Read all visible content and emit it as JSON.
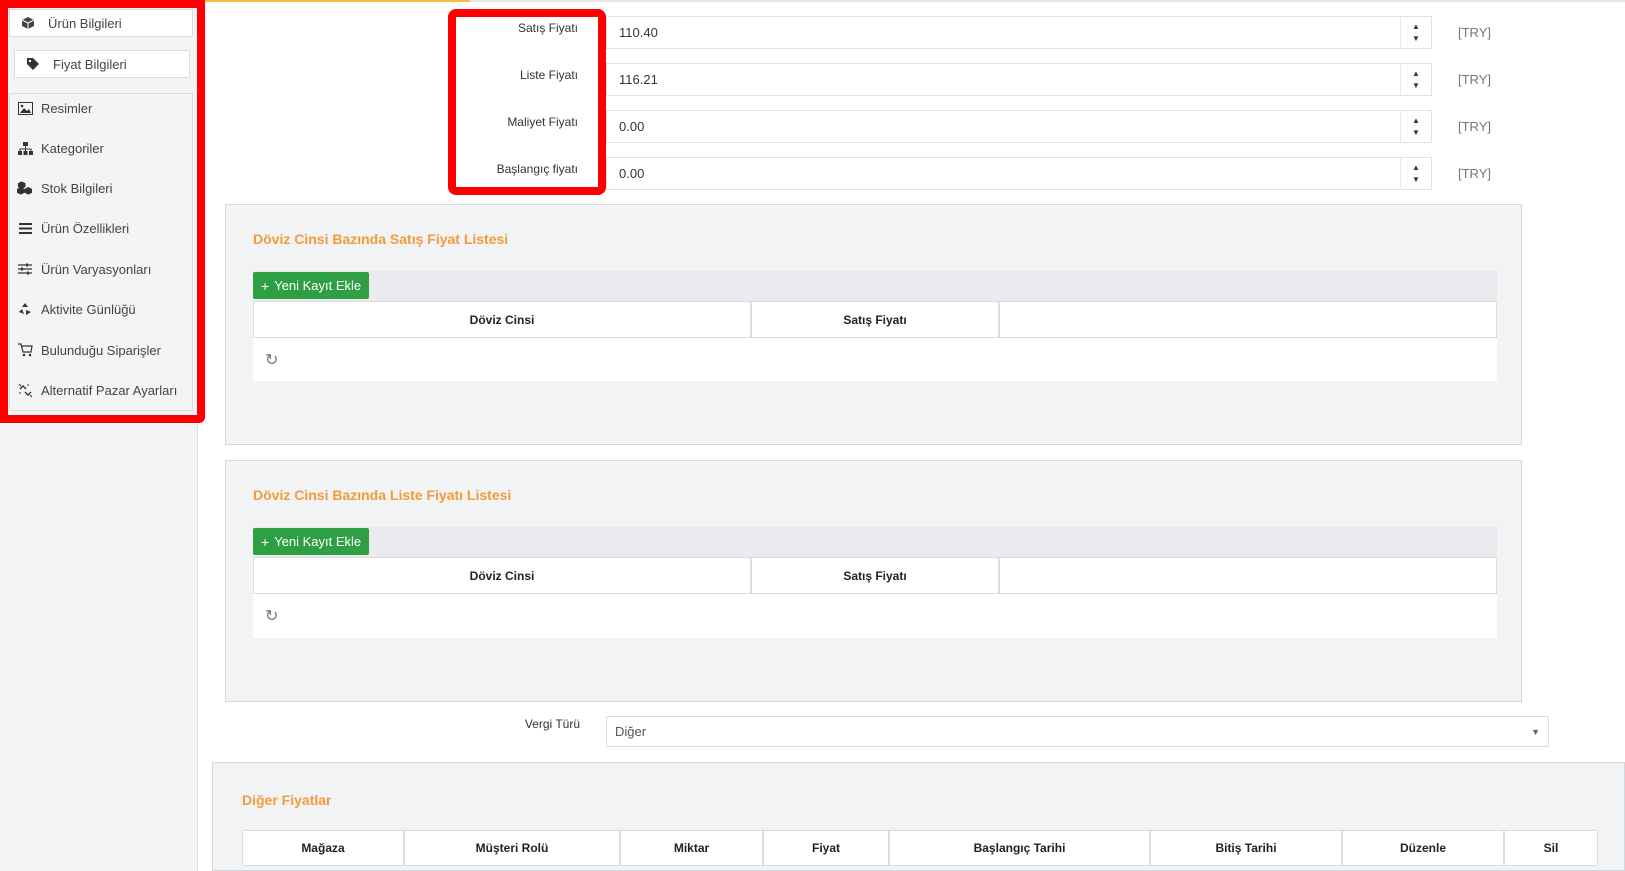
{
  "sidebar": {
    "tabs": [
      {
        "label": "Ürün Bilgileri",
        "icon": "cube-icon"
      },
      {
        "label": "Fiyat Bilgileri",
        "icon": "tag-icon"
      }
    ],
    "items": [
      {
        "label": "Resimler",
        "icon": "image-icon"
      },
      {
        "label": "Kategoriler",
        "icon": "sitemap-icon"
      },
      {
        "label": "Stok Bilgileri",
        "icon": "cubes-icon"
      },
      {
        "label": "Ürün Özellikleri",
        "icon": "list-icon"
      },
      {
        "label": "Ürün Varyasyonları",
        "icon": "sliders-icon"
      },
      {
        "label": "Aktivite Günlüğü",
        "icon": "recycle-icon"
      },
      {
        "label": "Bulunduğu Siparişler",
        "icon": "cart-icon"
      },
      {
        "label": "Alternatif Pazar Ayarları",
        "icon": "unlink-icon"
      }
    ]
  },
  "prices": [
    {
      "label": "Satış Fiyatı",
      "value": "110.40",
      "currency": "[TRY]"
    },
    {
      "label": "Liste Fiyatı",
      "value": "116.21",
      "currency": "[TRY]"
    },
    {
      "label": "Maliyet Fiyatı",
      "value": "0.00",
      "currency": "[TRY]"
    },
    {
      "label": "Başlangıç fiyatı",
      "value": "0.00",
      "currency": "[TRY]"
    }
  ],
  "sales_section": {
    "title": "Döviz Cinsi Bazında Satış Fiyat Listesi",
    "add_button": "Yeni Kayıt Ekle",
    "columns": [
      "Döviz Cinsi",
      "Satış Fiyatı",
      ""
    ]
  },
  "list_section": {
    "title": "Döviz Cinsi Bazında Liste Fiyatı Listesi",
    "add_button": "Yeni Kayıt Ekle",
    "columns": [
      "Döviz Cinsi",
      "Satış Fiyatı",
      ""
    ]
  },
  "tax": {
    "label": "Vergi Türü",
    "selected": "Diğer"
  },
  "other_prices": {
    "title": "Diğer Fiyatlar",
    "columns": [
      "Mağaza",
      "Müşteri Rolü",
      "Miktar",
      "Fiyat",
      "Başlangıç Tarihi",
      "Bitiş Tarihi",
      "Düzenle",
      "Sil"
    ]
  },
  "colors": {
    "accent_orange": "#f59a3a",
    "button_green": "#2ea043",
    "highlight_red": "#ff0000"
  }
}
